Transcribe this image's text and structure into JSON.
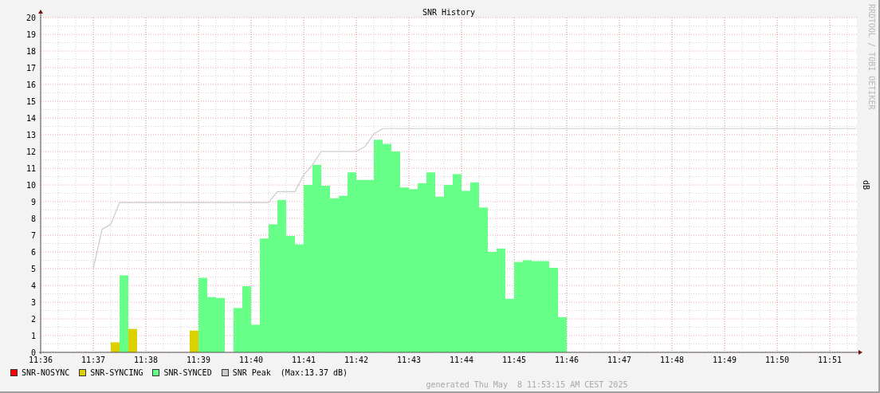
{
  "chart": {
    "chart_data": {
      "type": "bar",
      "title": "SNR History",
      "ylabel": "dB",
      "ylim": [
        0,
        20
      ],
      "grid": true,
      "yticks": [
        0,
        1,
        2,
        3,
        4,
        5,
        6,
        7,
        8,
        9,
        10,
        11,
        12,
        13,
        14,
        15,
        16,
        17,
        18,
        19,
        20
      ],
      "categories": [
        "11:36",
        null,
        null,
        null,
        null,
        null,
        "11:37",
        null,
        null,
        null,
        null,
        null,
        "11:38",
        null,
        null,
        null,
        null,
        null,
        "11:39",
        null,
        null,
        null,
        null,
        null,
        "11:40",
        null,
        null,
        null,
        null,
        null,
        "11:41",
        null,
        null,
        null,
        null,
        null,
        "11:42",
        null,
        null,
        null,
        null,
        null,
        "11:43",
        null,
        null,
        null,
        null,
        null,
        "11:44",
        null,
        null,
        null,
        null,
        null,
        "11:45",
        null,
        null,
        null,
        null,
        null,
        "11:46",
        null,
        null,
        null,
        null,
        null,
        "11:47",
        null,
        null,
        null,
        null,
        null,
        "11:48",
        null,
        null,
        null,
        null,
        null,
        "11:49",
        null,
        null,
        null,
        null,
        null,
        "11:50",
        null,
        null,
        null,
        null,
        null,
        "11:51",
        null,
        null,
        null
      ],
      "series": [
        {
          "name": "SNR-NOSYNC",
          "color": "#ff0000",
          "values": [
            null,
            null,
            null,
            null,
            null,
            null,
            null,
            null,
            null,
            null,
            null,
            null,
            null,
            null,
            null,
            null,
            null,
            null,
            null,
            null,
            null,
            null,
            null,
            null,
            null,
            null,
            null,
            null,
            null,
            null,
            null,
            null,
            null,
            null,
            null,
            null,
            null,
            null,
            null,
            null,
            null,
            null,
            null,
            null,
            null,
            null,
            null,
            null,
            null,
            null,
            null,
            null,
            null,
            null,
            null,
            null,
            null,
            null,
            null,
            null,
            null,
            null,
            null,
            null,
            null,
            null,
            null,
            null,
            null,
            null,
            null,
            null,
            null,
            null,
            null,
            null,
            null,
            null,
            null,
            null,
            null,
            null,
            null,
            null,
            null,
            null,
            null,
            null,
            null,
            null,
            null,
            null,
            null,
            null
          ]
        },
        {
          "name": "SNR-SYNCING",
          "color": "#ddd000",
          "values": [
            null,
            null,
            null,
            null,
            null,
            null,
            null,
            null,
            0.6,
            null,
            1.4,
            null,
            null,
            null,
            null,
            null,
            null,
            1.3,
            null,
            null,
            null,
            null,
            null,
            null,
            null,
            null,
            null,
            null,
            null,
            null,
            null,
            null,
            null,
            null,
            null,
            null,
            null,
            null,
            null,
            null,
            null,
            null,
            null,
            null,
            null,
            null,
            null,
            null,
            null,
            null,
            null,
            null,
            null,
            null,
            null,
            null,
            null,
            null,
            null,
            null,
            null,
            null,
            null,
            null,
            null,
            null,
            null,
            null,
            null,
            null,
            null,
            null,
            null,
            null,
            null,
            null,
            null,
            null,
            null,
            null,
            null,
            null,
            null,
            null,
            null,
            null,
            null,
            null,
            null,
            null,
            null,
            null,
            null,
            null
          ]
        },
        {
          "name": "SNR-SYNCED",
          "color": "#66ff88",
          "values": [
            null,
            null,
            null,
            null,
            null,
            null,
            null,
            null,
            null,
            4.6,
            null,
            null,
            null,
            null,
            null,
            null,
            null,
            null,
            4.45,
            3.3,
            3.25,
            null,
            2.65,
            3.95,
            1.65,
            6.8,
            7.65,
            9.1,
            6.95,
            6.45,
            10.0,
            11.2,
            9.95,
            9.2,
            9.35,
            10.75,
            10.3,
            10.3,
            12.7,
            12.45,
            12.0,
            9.85,
            9.75,
            10.1,
            10.75,
            9.3,
            10.0,
            10.65,
            9.65,
            10.15,
            8.65,
            6.0,
            6.2,
            3.2,
            5.4,
            5.5,
            5.45,
            5.45,
            5.05,
            2.1,
            null,
            null,
            null,
            null,
            null,
            null,
            null,
            null,
            null,
            null,
            null,
            null,
            null,
            null,
            null,
            null,
            null,
            null,
            null,
            null,
            null,
            null,
            null,
            null,
            null,
            null,
            null,
            null,
            null,
            null,
            null,
            null,
            null,
            null
          ]
        }
      ]
    },
    "peak_chart": {
      "chart_data": {
        "type": "line",
        "ylim": [
          0,
          20
        ],
        "series": [
          {
            "name": "SNR Peak",
            "color": "#cccccc",
            "values": [
              null,
              null,
              null,
              null,
              null,
              null,
              5.0,
              7.35,
              7.65,
              8.95,
              8.95,
              8.95,
              8.95,
              8.95,
              8.95,
              8.95,
              8.95,
              8.95,
              8.95,
              8.95,
              8.95,
              8.95,
              8.95,
              8.95,
              8.95,
              8.95,
              8.95,
              9.6,
              9.6,
              9.6,
              10.6,
              11.2,
              12.0,
              12.0,
              12.0,
              12.0,
              12.0,
              12.3,
              13.05,
              13.37,
              13.37,
              13.37,
              13.37,
              13.37,
              13.37,
              13.37,
              13.37,
              13.37,
              13.37,
              13.37,
              13.37,
              13.37,
              13.37,
              13.37,
              13.37,
              13.37,
              13.37,
              13.37,
              13.37,
              13.37,
              13.37,
              13.37,
              13.37,
              13.37,
              13.37,
              13.37,
              13.37,
              13.37,
              13.37,
              13.37,
              13.37,
              13.37,
              13.37,
              13.37,
              13.37,
              13.37,
              13.37,
              13.37,
              13.37,
              13.37,
              13.37,
              13.37,
              13.37,
              13.37,
              13.37,
              13.37,
              13.37,
              13.37,
              13.37,
              13.37,
              13.37,
              13.37,
              13.37,
              13.37
            ]
          }
        ]
      }
    },
    "credit": "RRDTOOL / TOBI OETIKER",
    "legend_note": "(Max:13.37 dB)"
  },
  "footer": "generated Thu May  8 11:53:15 AM CEST 2025"
}
